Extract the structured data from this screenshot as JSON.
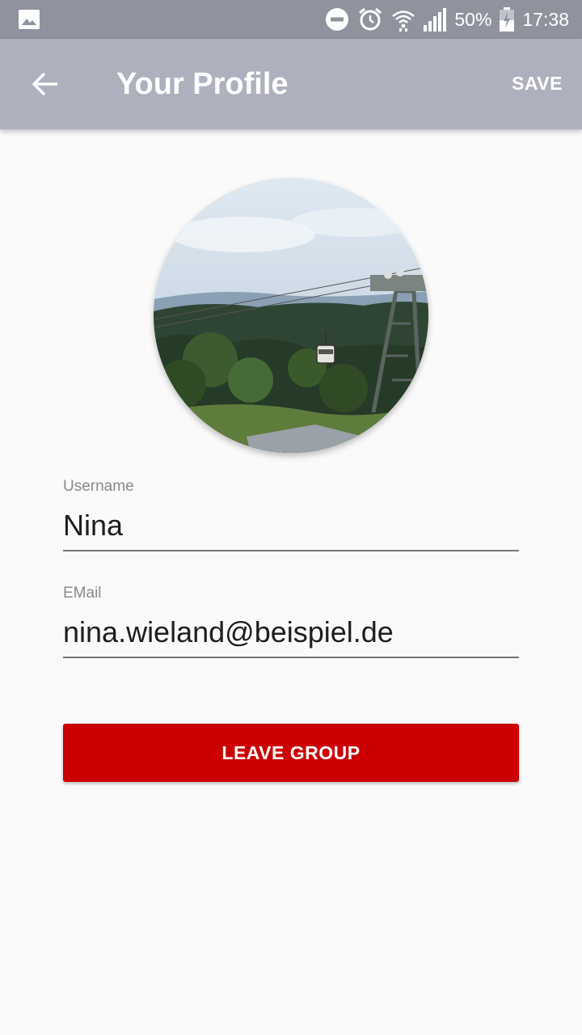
{
  "status_bar": {
    "battery": "50%",
    "time": "17:38",
    "icons": [
      "image-icon",
      "do-not-disturb-icon",
      "alarm-icon",
      "wifi-icon",
      "signal-icon",
      "battery-icon"
    ]
  },
  "app_bar": {
    "title": "Your Profile",
    "save_label": "SAVE",
    "back_icon": "arrow-back-icon"
  },
  "profile": {
    "avatar": "profile-photo"
  },
  "form": {
    "username_label": "Username",
    "username_value": "Nina",
    "email_label": "EMail",
    "email_value": "nina.wieland@beispiel.de"
  },
  "actions": {
    "leave_label": "LEAVE GROUP"
  },
  "colors": {
    "status_bar": "#8f939e",
    "app_bar": "#aeb1bd",
    "leave_button": "#cc0000",
    "background": "#fafafa"
  }
}
